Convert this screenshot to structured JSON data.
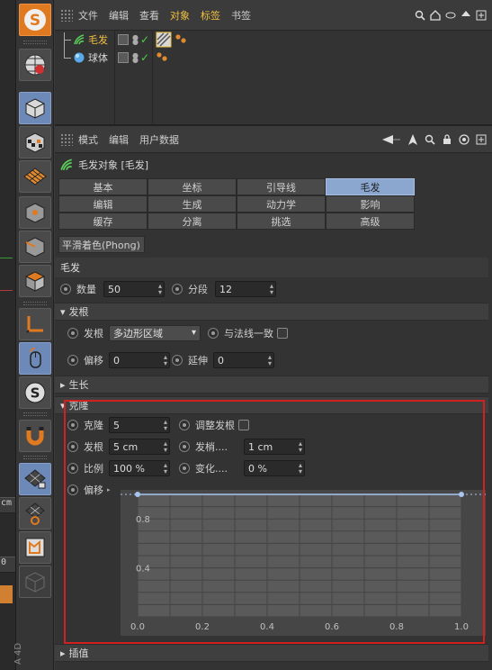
{
  "colors": {
    "accent_blue": "#8ba6cf",
    "highlight_yellow": "#f0c040",
    "annotation_red": "#d02020",
    "graph_line": "#a8c4ef"
  },
  "sliver": {
    "tab1": "cm",
    "tab2": "0"
  },
  "toolbar_icons": [
    "s-logo-icon",
    "globe-grid-icon",
    "cube-icon",
    "checker-cube-icon",
    "plane-grid-icon",
    "cube-point-icon",
    "cube-edge-icon",
    "cube-face-icon",
    "axis-corner-icon",
    "mouse-icon",
    "s-snap-icon",
    "magnet-icon",
    "grid-lock-icon",
    "grid-rotate-icon",
    "uv-edit-icon",
    "ghost-cube-icon"
  ],
  "toolbar_footer": "A 4D",
  "object_manager": {
    "menu": [
      "文件",
      "编辑",
      "查看",
      "对象",
      "标签",
      "书签"
    ],
    "objects": [
      {
        "name": "毛发",
        "icon": "hair-icon"
      },
      {
        "name": "球体",
        "icon": "sphere-icon"
      }
    ]
  },
  "attribute_manager": {
    "menu": [
      "模式",
      "编辑",
      "用户数据"
    ],
    "object_title": "毛发对象 [毛发]",
    "tabs": [
      [
        "基本",
        "坐标",
        "引导线",
        "毛发"
      ],
      [
        "编辑",
        "生成",
        "动力学",
        "影响"
      ],
      [
        "缓存",
        "分离",
        "挑选",
        "高级"
      ]
    ],
    "active_tab": "毛发",
    "phong_tab": "平滑着色(Phong)",
    "section_title": "毛发",
    "count": {
      "label": "数量",
      "value": "50"
    },
    "segments": {
      "label": "分段",
      "value": "12"
    },
    "root_section": "发根",
    "root": {
      "label": "发根",
      "value": "多边形区域",
      "align_label": "与法线一致"
    },
    "offset": {
      "label": "偏移",
      "value": "0"
    },
    "extend": {
      "label": "延伸",
      "value": "0"
    },
    "growth_section": "生长",
    "clone_section": "克隆",
    "clone": {
      "clones": {
        "label": "克隆",
        "value": "5"
      },
      "adjust_root": {
        "label": "调整发根"
      },
      "root": {
        "label": "发根",
        "value": "5 cm"
      },
      "tip": {
        "label": "发梢....",
        "value": "1 cm"
      },
      "scale": {
        "label": "比例",
        "value": "100 %"
      },
      "variation": {
        "label": "变化....",
        "value": "0 %"
      },
      "offset": {
        "label": "偏移"
      }
    },
    "interp_section": "插值"
  },
  "chart_data": {
    "type": "line",
    "x": [
      0.0,
      1.0
    ],
    "y": [
      1.0,
      1.0
    ],
    "xlim": [
      0.0,
      1.0
    ],
    "ylim": [
      0.0,
      1.0
    ],
    "x_ticks": [
      "0.0",
      "0.2",
      "0.4",
      "0.6",
      "0.8",
      "1.0"
    ],
    "y_ticks": [
      "0.8",
      "0.4"
    ],
    "grid": true
  }
}
